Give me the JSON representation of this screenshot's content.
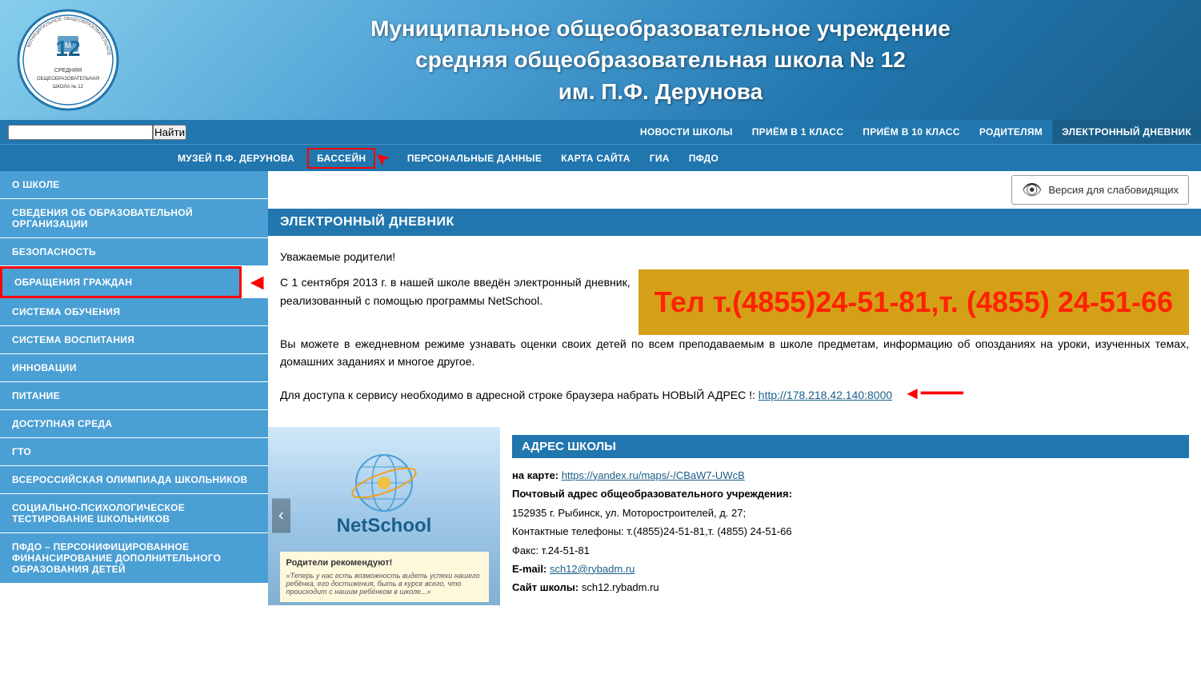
{
  "header": {
    "title_line1": "Муниципальное общеобразовательное  учреждение",
    "title_line2": "средняя общеобразовательная школа № 12",
    "title_line3": "им. П.Ф. Дерунова",
    "logo_number": "12"
  },
  "nav": {
    "search_placeholder": "",
    "search_btn": "Найти",
    "row1": [
      {
        "label": "НОВОСТИ ШКОЛЫ",
        "active": false
      },
      {
        "label": "ПРИЁМ В 1 КЛАСС",
        "active": false
      },
      {
        "label": "ПРИЁМ В 10 КЛАСС",
        "active": false
      },
      {
        "label": "РОДИТЕЛЯМ",
        "active": false
      },
      {
        "label": "ЭЛЕКТРОННЫЙ ДНЕВНИК",
        "active": true
      }
    ],
    "row2": [
      {
        "label": "МУЗЕЙ П.Ф. ДЕРУНОВА",
        "active": false
      },
      {
        "label": "БАССЕЙН",
        "active": false,
        "highlighted": true
      },
      {
        "label": "ПЕРСОНАЛЬНЫЕ ДАННЫЕ",
        "active": false
      },
      {
        "label": "КАРТА САЙТА",
        "active": false
      },
      {
        "label": "ГИА",
        "active": false
      },
      {
        "label": "ПФДО",
        "active": false
      }
    ]
  },
  "sidebar": {
    "items": [
      {
        "label": "О ШКОЛЕ"
      },
      {
        "label": "СВЕДЕНИЯ ОБ ОБРАЗОВАТЕЛЬНОЙ ОРГАНИЗАЦИИ"
      },
      {
        "label": "БЕЗОПАСНОСТЬ"
      },
      {
        "label": "ОБРАЩЕНИЯ ГРАЖДАН",
        "highlighted": true
      },
      {
        "label": "СИСТЕМА ОБУЧЕНИЯ"
      },
      {
        "label": "СИСТЕМА ВОСПИТАНИЯ"
      },
      {
        "label": "ИННОВАЦИИ"
      },
      {
        "label": "ПИТАНИЕ"
      },
      {
        "label": "ДОСТУПНАЯ СРЕДА"
      },
      {
        "label": "ГТО"
      },
      {
        "label": "ВСЕРОССИЙСКАЯ ОЛИМПИАДА ШКОЛЬНИКОВ"
      },
      {
        "label": "СОЦИАЛЬНО-ПСИХОЛОГИЧЕСКОЕ ТЕСТИРОВАНИЕ ШКОЛЬНИКОВ"
      },
      {
        "label": "ПФДО – ПЕРСОНИФИЦИРОВАННОЕ ФИНАНСИРОВАНИЕ ДОПОЛНИТЕЛЬНОГО ОБРАЗОВАНИЯ ДЕТЕЙ"
      }
    ]
  },
  "content": {
    "vision_btn": "Версия для слабовидящих",
    "section_title": "ЭЛЕКТРОННЫЙ ДНЕВНИК",
    "para1": "Уважаемые родители!",
    "para2": "С 1 сентября 2013 г. ...",
    "para2_full": "С 1 сентября 2013 г. в нашей школе введён электронный дневник, реализованный с помощью программы NetSchool.",
    "para3": "Вы можете в ежедневном режиме узнавать оценки своих детей по всем преподаваемым в школе предметам, информацию об опозданиях на уроки, изученных темах, домашних заданиях и многое другое.",
    "para4_prefix": "Для доступа к сервису необходимо в адресной строке браузера набрать НОВЫЙ АДРЕС !: ",
    "para4_link": "http://178.218.42.140:8000",
    "phone_text": "Тел т.(4855)24-51-81,т. (4855) 24-51-66",
    "address_section_title": "АДРЕС ШКОЛЫ",
    "address_map_label": "на карте: ",
    "address_map_link": "https://yandex.ru/maps/-/CBaW7-UWcB",
    "address_postal": "Почтовый адрес общеобразовательного учреждения:",
    "address_line1": "152935 г. Рыбинск, ул. Моторостроителей, д. 27;",
    "address_contacts": "Контактные телефоны:  т.(4855)24-51-81,т. (4855) 24-51-66",
    "address_fax": "Факс: т.24-51-81",
    "address_email_label": "E-mail: ",
    "address_email": "sch12@rybadm.ru",
    "address_site_label": "Сайт школы: ",
    "address_site": "sch12.rybadm.ru"
  },
  "netschool": {
    "title": "NetSchool",
    "recommend": "Родители рекомендуют!",
    "quote": "«Теперь у нас есть возможность видеть успехи нашего ребёнка, его достижения, быть в курсе всего, что происходит с нашим ребёнком в школе...»"
  }
}
